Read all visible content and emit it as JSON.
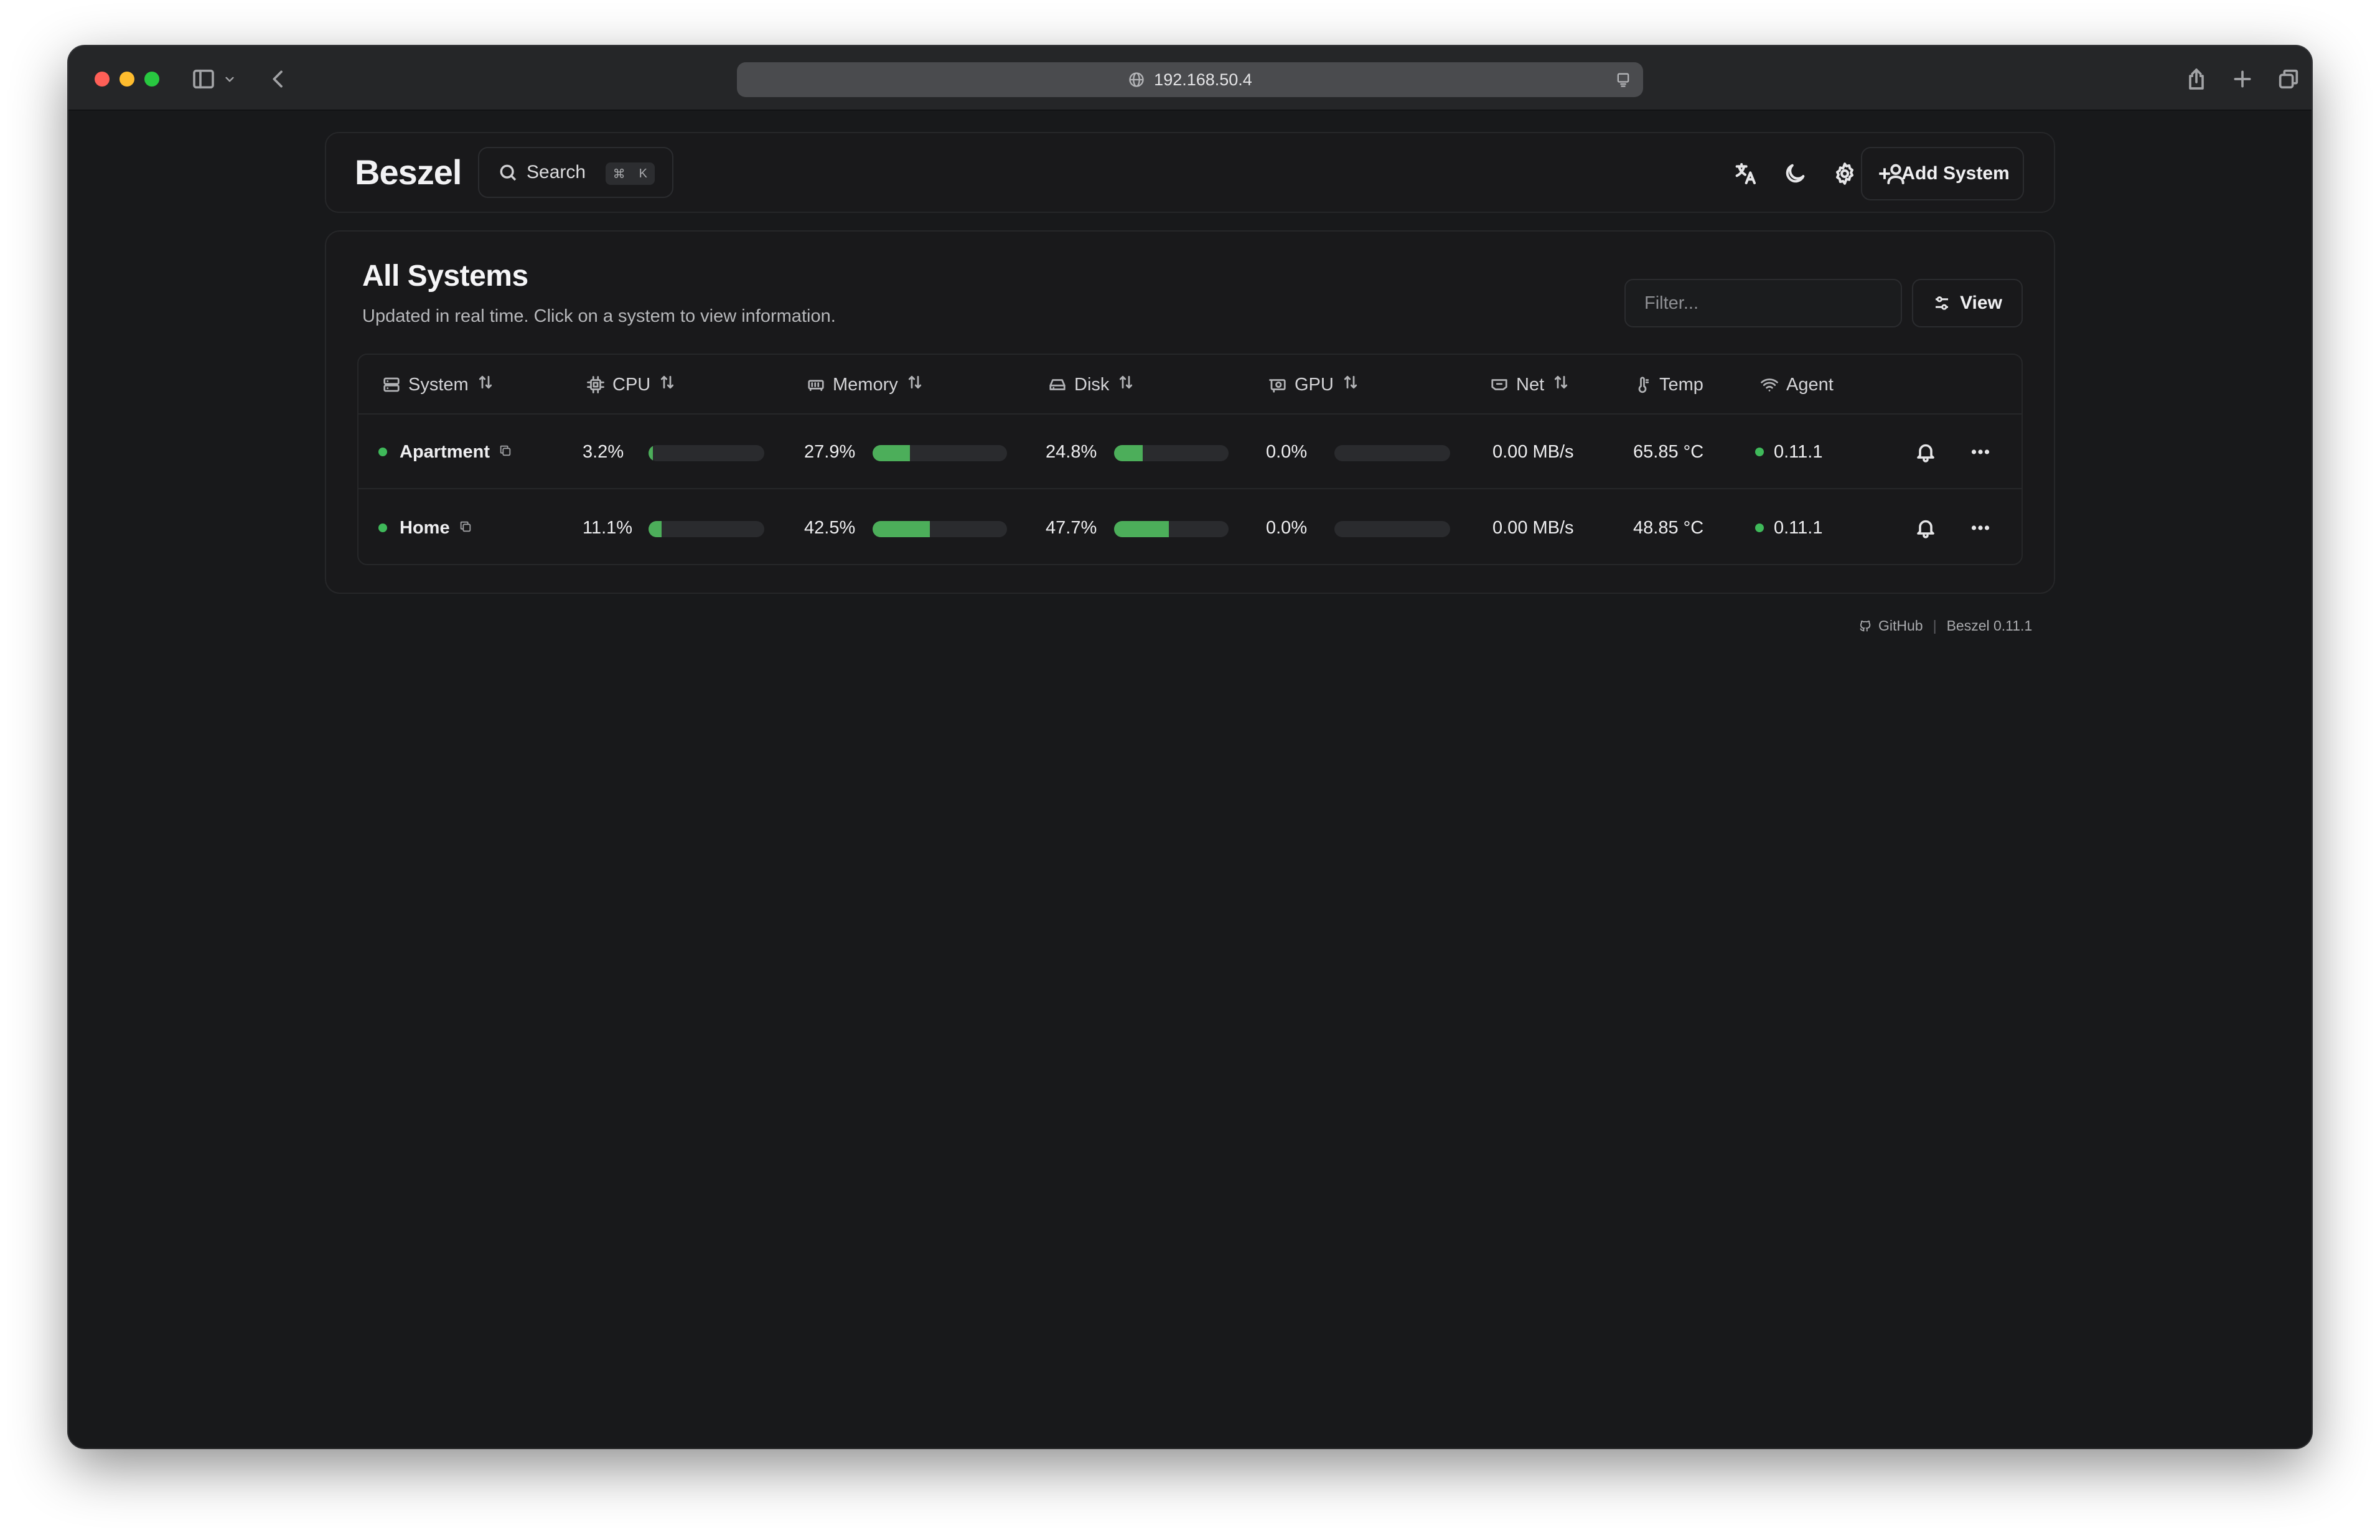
{
  "browser": {
    "url": "192.168.50.4"
  },
  "app": {
    "logo": "Beszel",
    "search_label": "Search",
    "search_shortcut_mod": "⌘",
    "search_shortcut_key": "K",
    "add_system_label": "Add System"
  },
  "main": {
    "title": "All Systems",
    "subtitle": "Updated in real time. Click on a system to view information.",
    "filter_placeholder": "Filter...",
    "view_label": "View"
  },
  "table": {
    "headers": {
      "system": "System",
      "cpu": "CPU",
      "memory": "Memory",
      "disk": "Disk",
      "gpu": "GPU",
      "net": "Net",
      "temp": "Temp",
      "agent": "Agent"
    },
    "rows": [
      {
        "name": "Apartment",
        "status_color": "#3fb95a",
        "cpu": "3.2%",
        "cpu_level": 3.2,
        "memory": "27.9%",
        "memory_level": 27.9,
        "disk": "24.8%",
        "disk_level": 24.8,
        "gpu": "0.0%",
        "gpu_level": 0,
        "net": "0.00 MB/s",
        "temp": "65.85 °C",
        "agent": "0.11.1"
      },
      {
        "name": "Home",
        "status_color": "#3fb95a",
        "cpu": "11.1%",
        "cpu_level": 11.1,
        "memory": "42.5%",
        "memory_level": 42.5,
        "disk": "47.7%",
        "disk_level": 47.7,
        "gpu": "0.0%",
        "gpu_level": 0,
        "net": "0.00 MB/s",
        "temp": "48.85 °C",
        "agent": "0.11.1"
      }
    ]
  },
  "footer": {
    "github": "GitHub",
    "version": "Beszel 0.11.1"
  },
  "colors": {
    "accent_green": "#4cae5a",
    "background": "#18191b"
  }
}
